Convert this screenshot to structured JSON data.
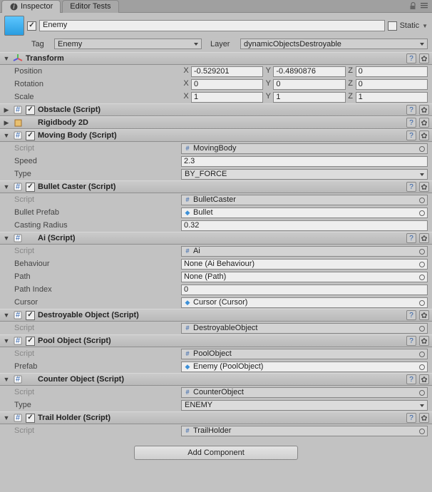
{
  "tabs": {
    "inspector": "Inspector",
    "editor_tests": "Editor Tests"
  },
  "header": {
    "name": "Enemy",
    "static_label": "Static",
    "tag_label": "Tag",
    "tag_value": "Enemy",
    "layer_label": "Layer",
    "layer_value": "dynamicObjectsDestroyable"
  },
  "transform": {
    "title": "Transform",
    "position_label": "Position",
    "pos_x": "-0.529201",
    "pos_y": "-0.4890876",
    "pos_z": "0",
    "rotation_label": "Rotation",
    "rot_x": "0",
    "rot_y": "0",
    "rot_z": "0",
    "scale_label": "Scale",
    "scl_x": "1",
    "scl_y": "1",
    "scl_z": "1"
  },
  "obstacle": {
    "title": "Obstacle (Script)"
  },
  "rigidbody": {
    "title": "Rigidbody 2D"
  },
  "movingbody": {
    "title": "Moving Body (Script)",
    "script_label": "Script",
    "script_value": "MovingBody",
    "speed_label": "Speed",
    "speed_value": "2.3",
    "type_label": "Type",
    "type_value": "BY_FORCE"
  },
  "bulletcaster": {
    "title": "Bullet Caster (Script)",
    "script_label": "Script",
    "script_value": "BulletCaster",
    "prefab_label": "Bullet Prefab",
    "prefab_value": "Bullet",
    "radius_label": "Casting Radius",
    "radius_value": "0.32"
  },
  "ai": {
    "title": "Ai (Script)",
    "script_label": "Script",
    "script_value": "Ai",
    "behaviour_label": "Behaviour",
    "behaviour_value": "None (Ai Behaviour)",
    "path_label": "Path",
    "path_value": "None (Path)",
    "pathindex_label": "Path Index",
    "pathindex_value": "0",
    "cursor_label": "Cursor",
    "cursor_value": "Cursor (Cursor)"
  },
  "destroyable": {
    "title": "Destroyable Object (Script)",
    "script_label": "Script",
    "script_value": "DestroyableObject"
  },
  "pool": {
    "title": "Pool Object (Script)",
    "script_label": "Script",
    "script_value": "PoolObject",
    "prefab_label": "Prefab",
    "prefab_value": "Enemy (PoolObject)"
  },
  "counter": {
    "title": "Counter Object (Script)",
    "script_label": "Script",
    "script_value": "CounterObject",
    "type_label": "Type",
    "type_value": "ENEMY"
  },
  "trail": {
    "title": "Trail Holder (Script)",
    "script_label": "Script",
    "script_value": "TrailHolder"
  },
  "add_component": "Add Component",
  "axis": {
    "x": "X",
    "y": "Y",
    "z": "Z"
  }
}
